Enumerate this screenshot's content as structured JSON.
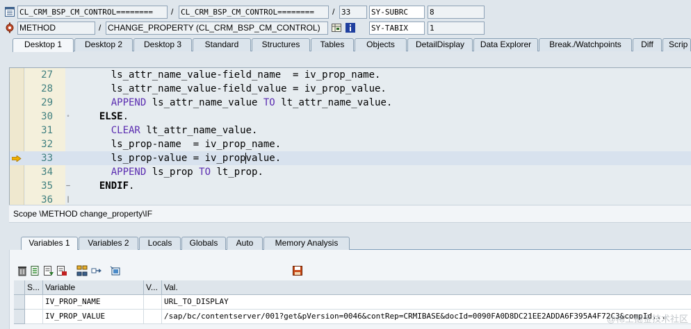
{
  "header": {
    "row1": {
      "program": "CL_CRM_BSP_CM_CONTROL========",
      "include": "CL_CRM_BSP_CM_CONTROL========",
      "line": "33",
      "sysvar_name": "SY-SUBRC",
      "sysvar_value": "8"
    },
    "row2": {
      "event_type": "METHOD",
      "event_name": "CHANGE_PROPERTY (CL_CRM_BSP_CM_CONTROL)",
      "sysvar_name": "SY-TABIX",
      "sysvar_value": "1"
    },
    "separator": "/"
  },
  "desktop_tabs": [
    "Desktop 1",
    "Desktop 2",
    "Desktop 3",
    "Standard",
    "Structures",
    "Tables",
    "Objects",
    "DetailDisplay",
    "Data Explorer",
    "Break./Watchpoints",
    "Diff",
    "Scrip"
  ],
  "code": {
    "lines": [
      {
        "num": "27",
        "pre": "    ls_attr_name_value-field_name  = iv_prop_name."
      },
      {
        "num": "28",
        "pre": "    ls_attr_name_value-field_value = iv_prop_value."
      },
      {
        "num": "29",
        "kw": "APPEND",
        "mid": " ls_attr_name_value ",
        "kw2": "TO",
        "post": " lt_attr_name_value."
      },
      {
        "num": "30",
        "kwb": "ELSE",
        "post": "."
      },
      {
        "num": "31",
        "kw": "CLEAR",
        "post": " lt_attr_name_value."
      },
      {
        "num": "32",
        "pre": "    ls_prop-name  = iv_prop_name."
      },
      {
        "num": "33",
        "pre": "    ls_prop-value = iv_prop",
        "post": "value."
      },
      {
        "num": "34",
        "kw": "APPEND",
        "mid": " ls_prop ",
        "kw2": "TO",
        "post": " lt_prop."
      },
      {
        "num": "35",
        "kwb": "ENDIF",
        "post": "."
      },
      {
        "num": "36",
        "pre": ""
      }
    ],
    "current_line": "33"
  },
  "scope": "Scope \\METHOD change_property\\IF",
  "variable_tabs": [
    "Variables 1",
    "Variables 2",
    "Locals",
    "Globals",
    "Auto",
    "Memory Analysis"
  ],
  "grid": {
    "headers": [
      "S...",
      "Variable",
      "V...",
      "Val."
    ],
    "rows": [
      {
        "variable": "IV_PROP_NAME",
        "value": "URL_TO_DISPLAY"
      },
      {
        "variable": "IV_PROP_VALUE",
        "value": "/sap/bc/contentserver/001?get&pVersion=0046&contRep=CRMIBASE&docId=0090FA0D8DC21EE2ADDA6F395A4F72C3&compId..."
      }
    ]
  },
  "watermark": "@稀土掘金技术社区",
  "colors": {
    "keyword": "#5a2bb0",
    "line_number": "#3f7f7f",
    "current_line_bg": "#d8e2ee",
    "arrow": "#e8a000"
  },
  "icons": [
    "list-icon",
    "gear-icon",
    "grid-icon",
    "info-icon",
    "delete-icon",
    "save-icon"
  ]
}
